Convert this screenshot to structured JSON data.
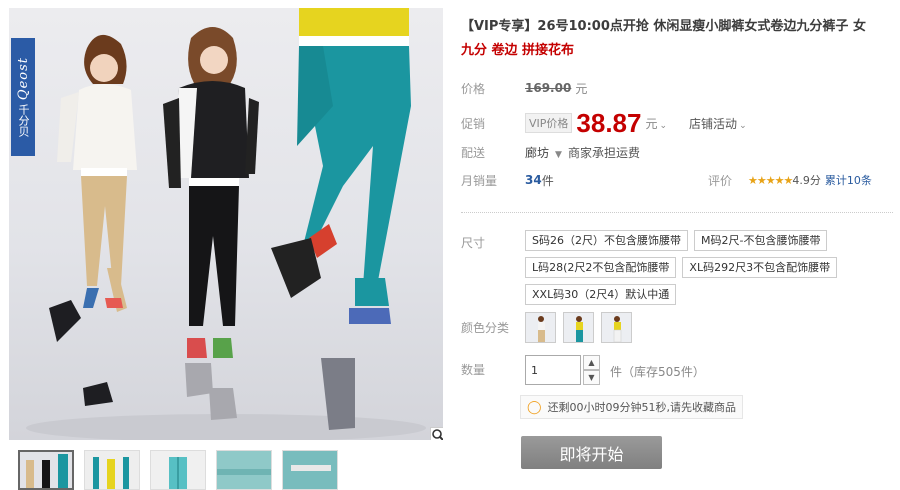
{
  "gallery": {
    "brand_en": "Qeost",
    "brand_zh": "千分贝",
    "zoom_icon": "magnifier-icon",
    "thumbnail_count": 5
  },
  "product": {
    "title": "【VIP专享】26号10:00点开抢 休闲显瘦小脚裤女式卷边九分裤子 女",
    "subtitle": "九分 卷边 拼接花布"
  },
  "price": {
    "label": "价格",
    "original": "169.00",
    "unit": "元"
  },
  "promo": {
    "label": "促销",
    "vip_tag": "VIP价格",
    "price": "38.87",
    "unit": "元",
    "store_activity": "店铺活动"
  },
  "shipping": {
    "label": "配送",
    "location": "廊坊",
    "freight": "商家承担运费"
  },
  "sales": {
    "label": "月销量",
    "count": "34",
    "unit": "件"
  },
  "rating": {
    "label": "评价",
    "stars": "★★★★★",
    "score": "4.9分",
    "reviews": "累计10条",
    "star_color": "#e8a317"
  },
  "size": {
    "label": "尺寸",
    "options": [
      "S码26（2尺）不包含腰饰腰带",
      "M码2尺-不包含腰饰腰带",
      "L码28(2尺2不包含配饰腰带",
      "XL码292尺3不包含配饰腰带",
      "XXL码30（2尺4）默认中通"
    ]
  },
  "color": {
    "label": "颜色分类",
    "swatches": [
      "khaki",
      "teal",
      "white"
    ]
  },
  "quantity": {
    "label": "数量",
    "value": "1",
    "stock": "件（库存505件）"
  },
  "notice": {
    "icon": "lightbulb-icon",
    "text": "还剩00小时09分钟51秒,请先收藏商品"
  },
  "action": {
    "button_label": "即将开始"
  },
  "colors": {
    "price_red": "#c40000",
    "link_blue": "#2a5b9f",
    "button_gray": "#8a8a8a"
  }
}
